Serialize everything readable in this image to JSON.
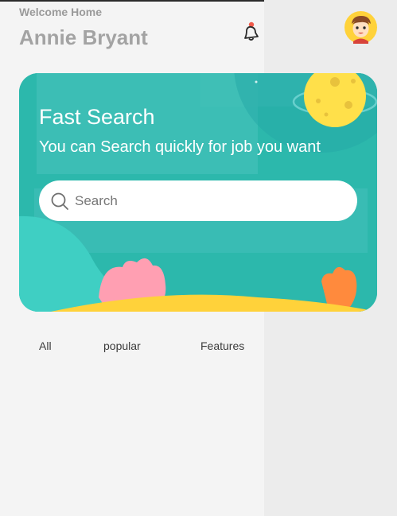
{
  "header": {
    "welcome": "Welcome Home",
    "user_name": "Annie Bryant",
    "notification_icon": "bell-icon",
    "avatar_icon": "cartoon-avatar"
  },
  "hero": {
    "title": "Fast Search",
    "subtitle": "You can Search quickly for job you want",
    "search_placeholder": "Search",
    "search_icon": "search-icon"
  },
  "tabs": [
    {
      "label": "All"
    },
    {
      "label": " popular"
    },
    {
      "label": " Features"
    }
  ],
  "colors": {
    "hero_teal": "#2cb8ac",
    "moon_yellow": "#ffe04a",
    "notification_dot": "#f05a4a"
  }
}
